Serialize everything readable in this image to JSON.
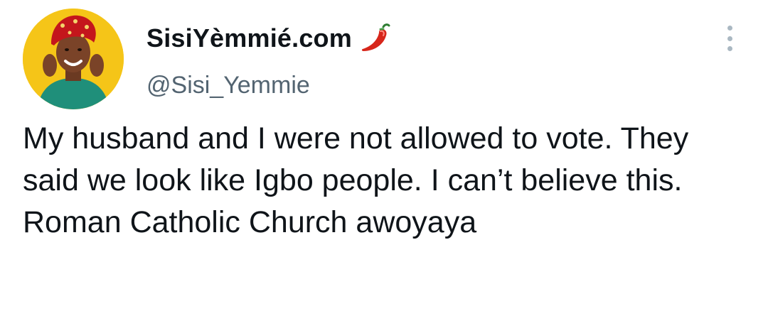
{
  "user": {
    "display_name": "SisiYèmmié.com",
    "handle": "@Sisi_Yemmie",
    "name_emoji": "chili-pepper-icon",
    "avatar": "profile-avatar"
  },
  "tweet": {
    "text": "My husband and I were not allowed to vote. They said we look like Igbo people. I can’t believe this. Roman Catholic Church awoyaya"
  },
  "menu": {
    "icon": "more-options-icon"
  },
  "colors": {
    "text": "#0f1419",
    "handle": "#536471",
    "avatar_bg": "#f5c518",
    "pepper": "#d7261b"
  }
}
